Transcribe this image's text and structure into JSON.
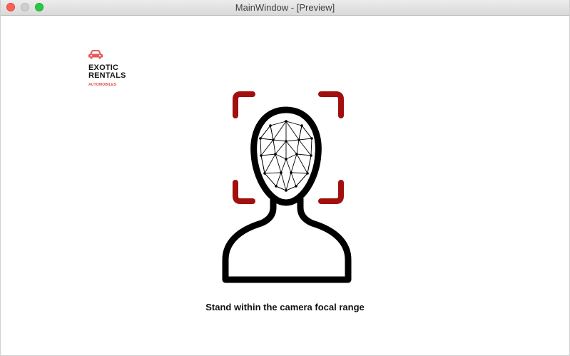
{
  "window": {
    "title": "MainWindow - [Preview]"
  },
  "logo": {
    "line1": "EXOTIC",
    "line2": "RENTALS",
    "tagline": "AUTOMOBILES",
    "icon": "car-icon",
    "accent_color": "#e35b5b"
  },
  "graphic": {
    "icon": "face-scan-icon",
    "frame_color": "#a10f0f",
    "outline_color": "#000000"
  },
  "instruction": {
    "text": "Stand within the camera focal range"
  }
}
